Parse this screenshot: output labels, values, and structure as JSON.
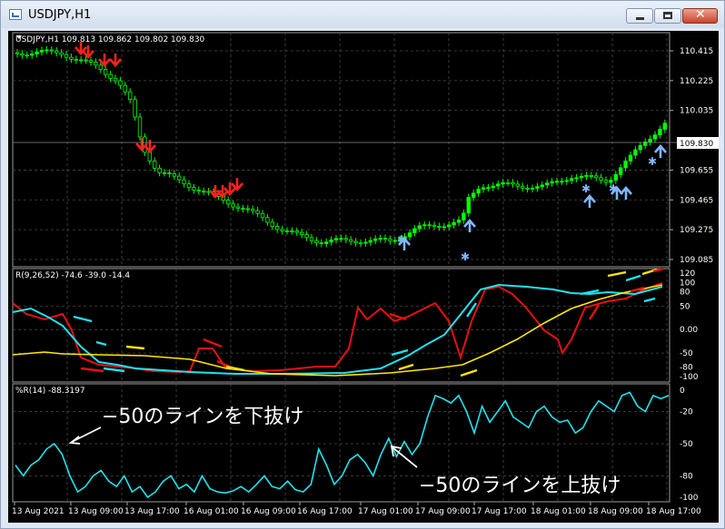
{
  "window": {
    "title": "USDJPY,H1",
    "buttons": {
      "minimize": "minimize-icon",
      "maximize": "maximize-icon",
      "close": "close-icon"
    }
  },
  "colors": {
    "background": "#000000",
    "grid": "#4a4a4a",
    "candle": "#00ff00",
    "down_arrow": "#ff2020",
    "up_arrow": "#7fb7ff",
    "red_line": "#e81010",
    "cyan_line": "#1ee4ee",
    "yellow_line": "#ffe800",
    "annotation_text": "#ffffff"
  },
  "main_panel": {
    "header": "USDJPY,H1  109.813 109.862 109.802 109.830",
    "price_labels": [
      "110.415",
      "110.225",
      "110.035",
      "109.655",
      "109.465",
      "109.275",
      "109.085"
    ],
    "current_price": "109.830"
  },
  "indicator_panel": {
    "header": "R(9,26,52) -74.6 -39.0 -14.4",
    "labels": [
      "120",
      "100",
      "80",
      "50",
      "0.00",
      "-50",
      "-80",
      "-100"
    ]
  },
  "wpr_panel": {
    "header": "%R(14) -88.3197",
    "labels": [
      "0",
      "-20",
      "-50",
      "-80",
      "-100"
    ],
    "annotation_down": "−50のラインを下抜け",
    "annotation_up": "−50のラインを上抜け"
  },
  "time_axis": {
    "labels": [
      "13 Aug 2021",
      "13 Aug 09:00",
      "13 Aug 17:00",
      "16 Aug 01:00",
      "16 Aug 09:00",
      "16 Aug 17:00",
      "17 Aug 01:00",
      "17 Aug 09:00",
      "17 Aug 17:00",
      "18 Aug 01:00",
      "18 Aug 09:00",
      "18 Aug 17:00"
    ]
  },
  "chart_data": {
    "type": "line",
    "symbol": "USDJPY",
    "timeframe": "H1",
    "ohlc": {
      "open": 109.813,
      "high": 109.862,
      "low": 109.802,
      "close": 109.83
    },
    "x": [
      "13 Aug 2021",
      "13 Aug 09:00",
      "13 Aug 17:00",
      "16 Aug 01:00",
      "16 Aug 09:00",
      "16 Aug 17:00",
      "17 Aug 01:00",
      "17 Aug 09:00",
      "17 Aug 17:00",
      "18 Aug 01:00",
      "18 Aug 09:00",
      "18 Aug 17:00"
    ],
    "price_close": [
      110.4,
      110.35,
      109.72,
      109.52,
      109.32,
      109.25,
      109.26,
      109.33,
      109.63,
      109.6,
      109.58,
      109.94
    ],
    "wpr_14": [
      -65,
      -55,
      -95,
      -92,
      -82,
      -88,
      -58,
      -5,
      -20,
      -35,
      -25,
      -5
    ],
    "ylim_price": [
      109.085,
      110.415
    ],
    "ylim_wpr": [
      -100,
      0
    ]
  }
}
